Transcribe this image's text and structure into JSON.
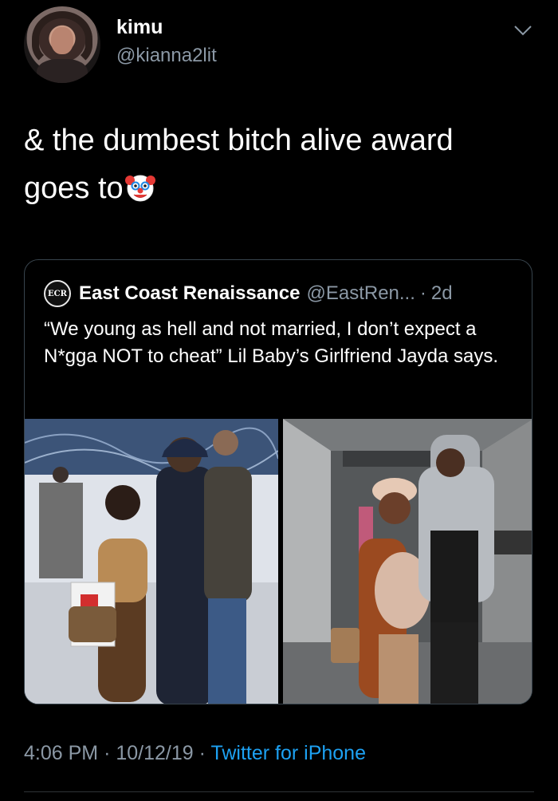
{
  "user": {
    "name": "kimu",
    "handle": "@kianna2lit"
  },
  "tweet": {
    "text_line1": "& the dumbest bitch alive award",
    "text_line2": "goes to",
    "emoji_icon": "clown-face-icon"
  },
  "quote": {
    "logo_text": "ECR",
    "name": "East Coast Renaissance",
    "handle": "@EastRen...",
    "separator": "·",
    "time": "2d",
    "text": "“We young as hell and not married, I don’t expect a N*gga NOT to cheat” Lil Baby’s Girlfriend Jayda says."
  },
  "footer": {
    "time": "4:06 PM",
    "sep1": "·",
    "date": "10/12/19",
    "sep2": "·",
    "source": "Twitter for iPhone"
  },
  "colors": {
    "background": "#000000",
    "text": "#ffffff",
    "secondary": "#8b98a5",
    "link": "#1da1f2",
    "border": "#38444d"
  }
}
